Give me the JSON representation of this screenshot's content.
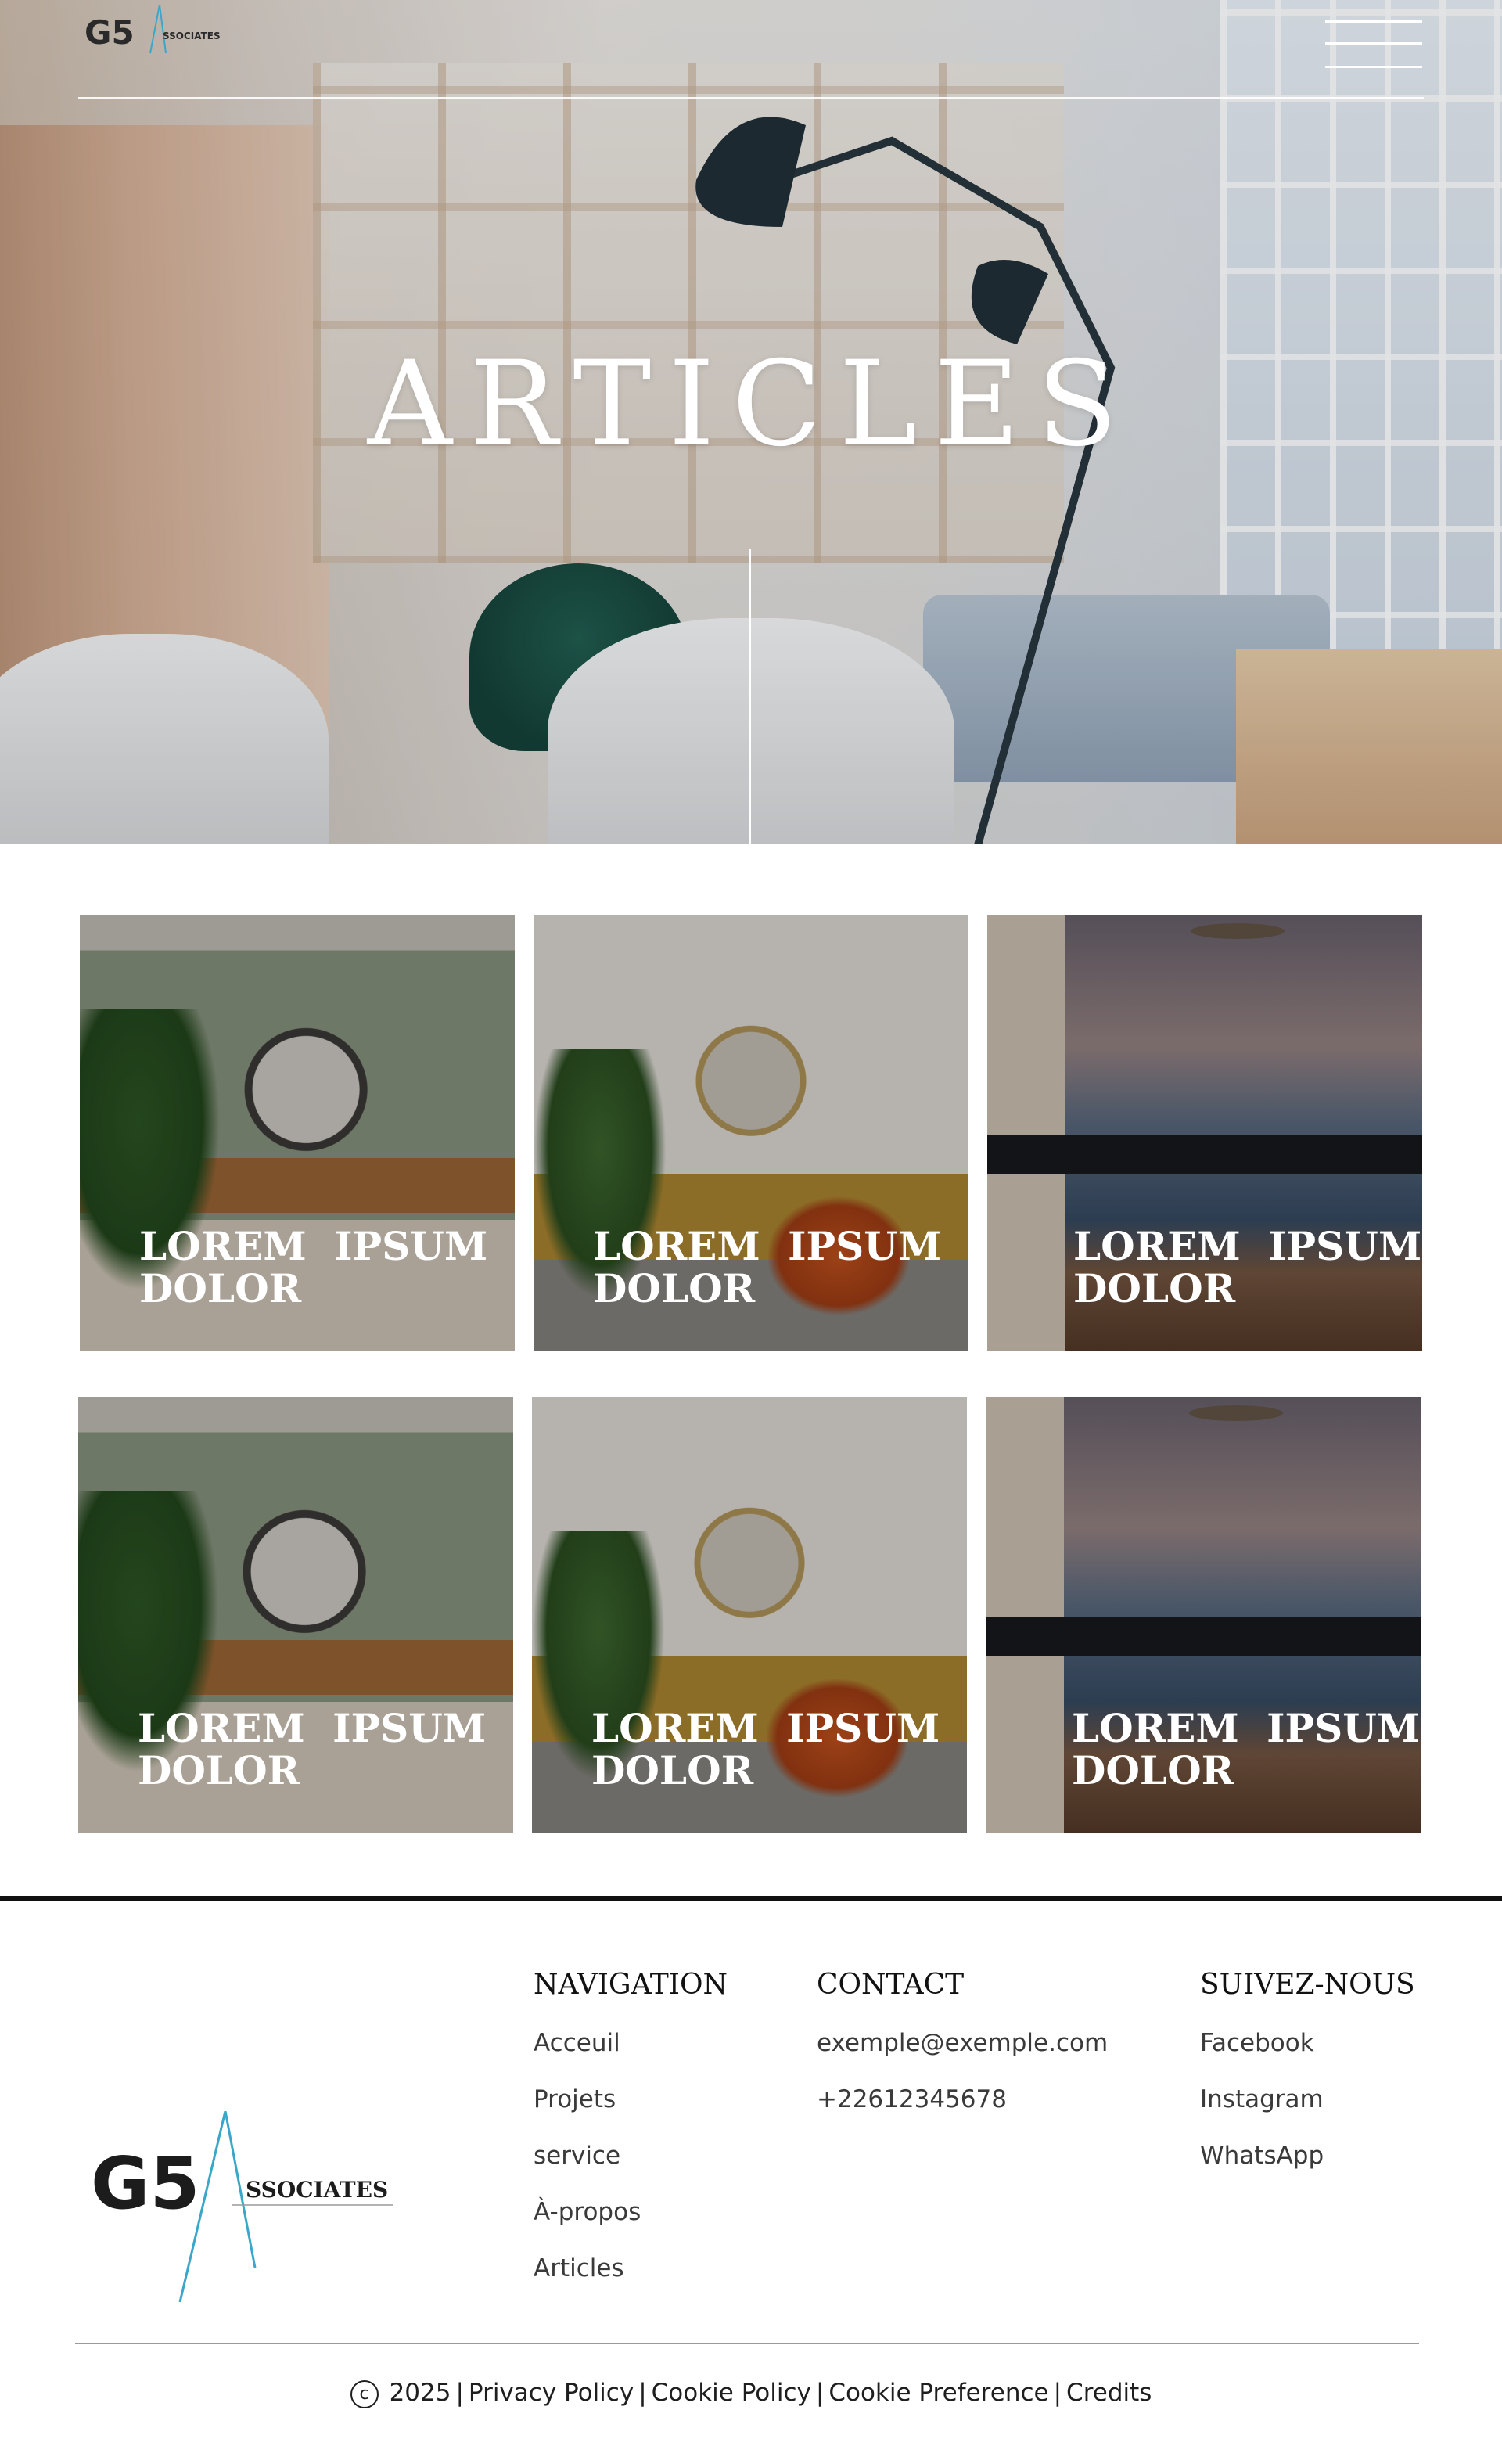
{
  "header": {
    "logo_text": "G5 ASSOCIATES",
    "menu_icon": "hamburger-menu-icon"
  },
  "hero": {
    "title": "ARTICLES"
  },
  "articles": [
    {
      "title": "LOREM IPSUM DOLOR",
      "scene": "green-living-room"
    },
    {
      "title": "LOREM IPSUM DOLOR",
      "scene": "orange-armchair-room"
    },
    {
      "title": "LOREM IPSUM DOLOR",
      "scene": "sea-view-dining-room"
    },
    {
      "title": "LOREM IPSUM DOLOR",
      "scene": "green-living-room"
    },
    {
      "title": "LOREM IPSUM DOLOR",
      "scene": "orange-armchair-room"
    },
    {
      "title": "LOREM IPSUM DOLOR",
      "scene": "sea-view-dining-room"
    }
  ],
  "footer": {
    "logo_text": "G5 ASSOCIATES",
    "navigation": {
      "heading": "NAVIGATION",
      "links": [
        "Acceuil",
        "Projets",
        "service",
        "À-propos",
        "Articles"
      ]
    },
    "contact": {
      "heading": "CONTACT",
      "email": "exemple@exemple.com",
      "phone": "+22612345678"
    },
    "social": {
      "heading": "SUIVEZ-NOUS",
      "links": [
        "Facebook",
        "Instagram",
        "WhatsApp"
      ]
    },
    "copyright": {
      "icon": "copyright-icon",
      "year": "2025",
      "separator": "|",
      "links": [
        "Privacy Policy",
        "Cookie Policy",
        "Cookie Preference",
        "Credits"
      ]
    }
  },
  "colors": {
    "accent_logo_line": "#3aa7c9",
    "footer_rule": "#111111",
    "text_dark": "#1e1e1e"
  }
}
